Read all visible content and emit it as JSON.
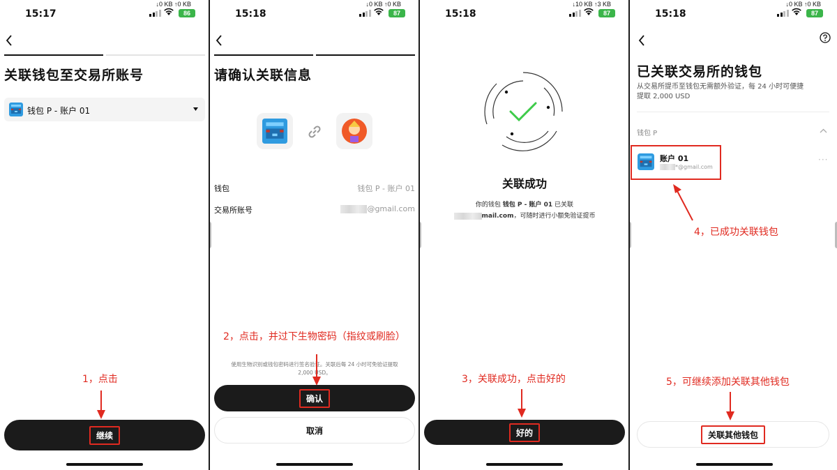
{
  "colors": {
    "accent_red": "#e02a20",
    "dark_button": "#1b1b1b",
    "success_green": "#3ecb4a",
    "battery_green": "#3bb54a"
  },
  "screens": [
    {
      "status": {
        "time": "15:17",
        "net_down": "↓0 KB",
        "net_up": "↑0 KB",
        "battery": "86"
      },
      "title": "关联钱包至交易所账号",
      "wallet_select": {
        "value": "钱包 P - 账户 01",
        "icon": "pixel-wallet-icon"
      },
      "button": "继续",
      "annotation": "1，点击"
    },
    {
      "status": {
        "time": "15:18",
        "net_down": "↓0 KB",
        "net_up": "↑0 KB",
        "battery": "87"
      },
      "title": "请确认关联信息",
      "rows": [
        {
          "label": "钱包",
          "value": "钱包 P - 账户 01"
        },
        {
          "label": "交易所账号",
          "value": "@gmail.com"
        }
      ],
      "disclaimer_line1": "使用生物识别或钱包密码进行签名验证。关联后每 24 小时可免验证提取",
      "disclaimer_line2": "2,000 USD。",
      "confirm_button": "确认",
      "cancel_button": "取消",
      "annotation": "2，点击，并过下生物密码（指纹或刷脸）"
    },
    {
      "status": {
        "time": "15:18",
        "net_down": "↓10 KB",
        "net_up": "↑3 KB",
        "battery": "87"
      },
      "success_title": "关联成功",
      "msg_pre": "你的钱包 ",
      "msg_wallet": "钱包 P - 账户 01",
      "msg_mid": " 已关联",
      "msg_email": "mail.com",
      "msg_post": "，可随时进行小额免验证提币",
      "button": "好的",
      "annotation": "3，关联成功，点击好的"
    },
    {
      "status": {
        "time": "15:18",
        "net_down": "↓0 KB",
        "net_up": "↑0 KB",
        "battery": "87"
      },
      "title": "已关联交易所的钱包",
      "subtitle_line1": "从交易所提币至钱包无需额外验证，每 24 小时可便捷",
      "subtitle_line2": "提取 2,000 USD",
      "section_label": "钱包 P",
      "account_name": "账户 01",
      "account_email": "*@gmail.com",
      "button": "关联其他钱包",
      "annotation_linked": "4，已成功关联钱包",
      "annotation_more": "5，可继续添加关联其他钱包"
    }
  ]
}
